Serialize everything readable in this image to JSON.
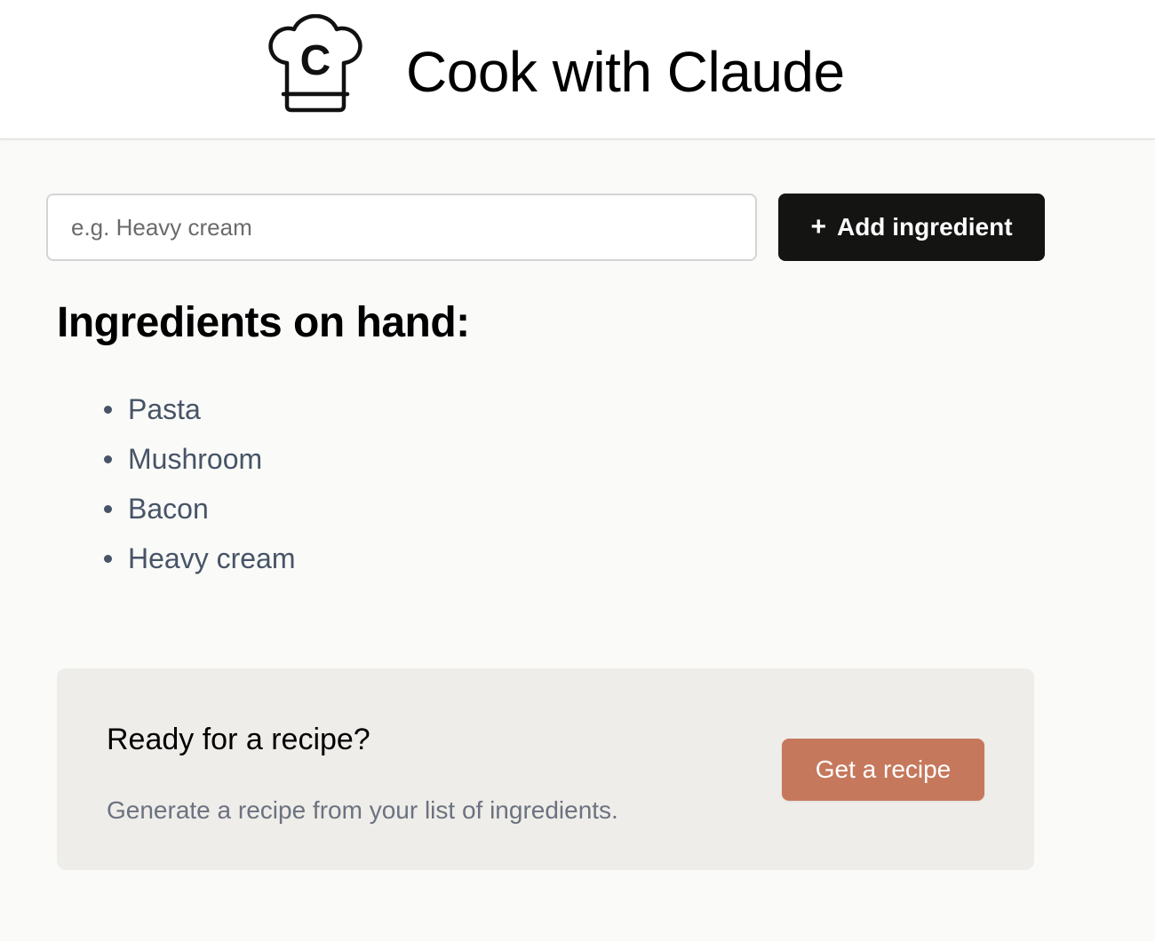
{
  "header": {
    "logo_icon": "chef-hat-icon",
    "logo_letter": "C",
    "title": "Cook with Claude"
  },
  "form": {
    "input_placeholder": "e.g. Heavy cream",
    "input_value": "",
    "add_button_icon": "plus-icon",
    "add_button_symbol": "+",
    "add_button_label": "Add ingredient"
  },
  "ingredients": {
    "heading": "Ingredients on hand:",
    "items": [
      "Pasta",
      "Mushroom",
      "Bacon",
      "Heavy cream"
    ]
  },
  "recipe_card": {
    "title": "Ready for a recipe?",
    "description": "Generate a recipe from your list of ingredients.",
    "button_label": "Get a recipe"
  },
  "colors": {
    "page_background": "#FAFAF8",
    "header_background": "#FFFFFF",
    "primary_button": "#141413",
    "accent_button": "#C6785D",
    "card_background": "#EFEDE9",
    "list_text": "#475467",
    "muted_text": "#6B7280"
  }
}
